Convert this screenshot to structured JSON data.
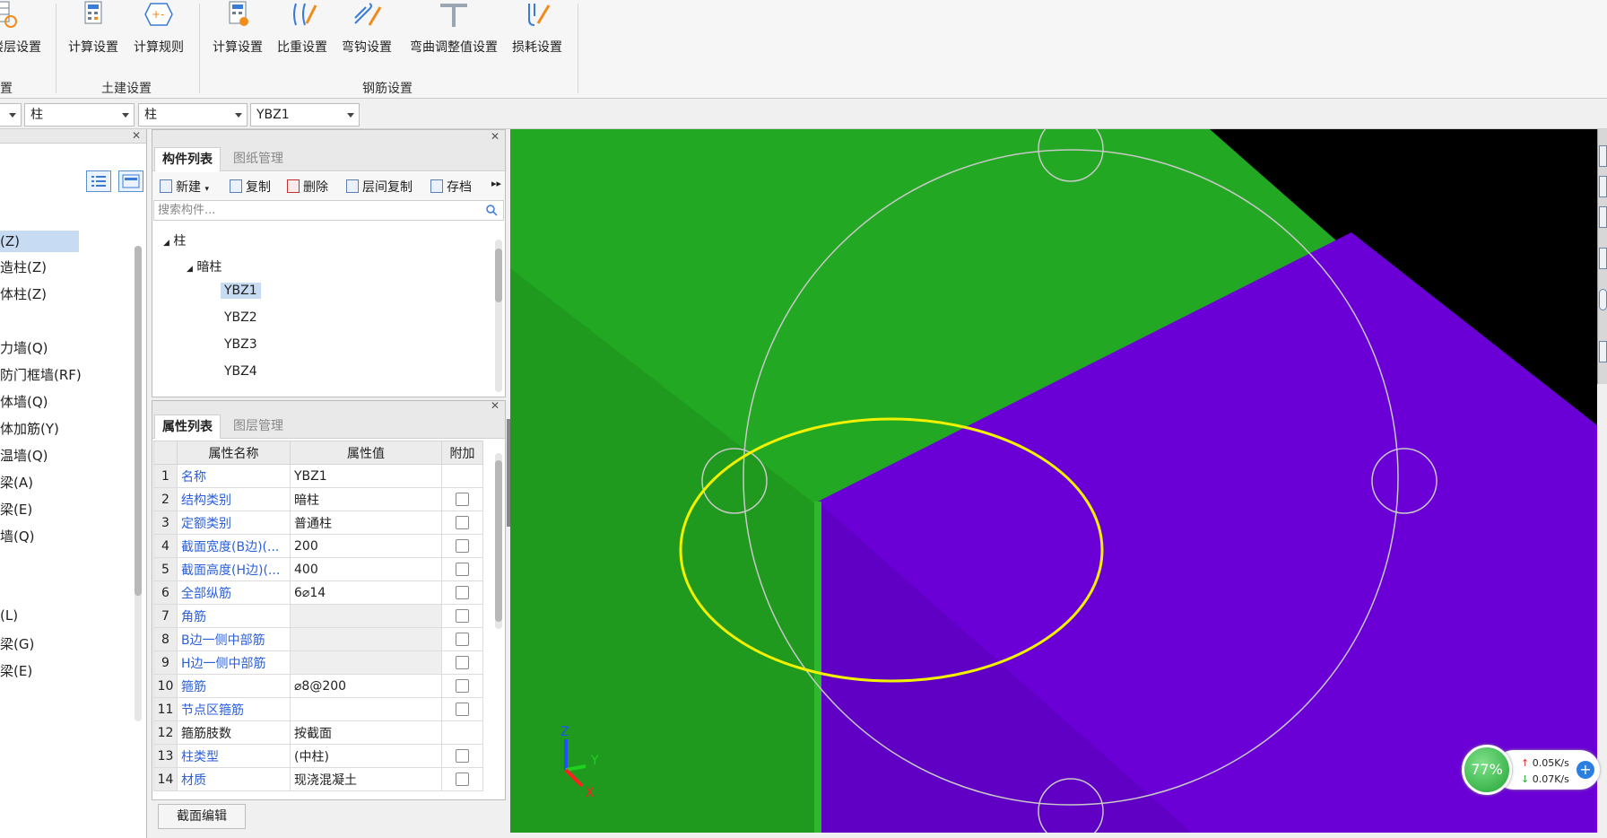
{
  "ribbon": {
    "buttons": [
      {
        "label": "楼层设置",
        "icon": "floor-settings-icon"
      },
      {
        "label": "计算设置",
        "icon": "calc-settings-icon"
      },
      {
        "label": "计算规则",
        "icon": "calc-rules-icon"
      },
      {
        "label": "计算设置",
        "icon": "rebar-calc-settings-icon"
      },
      {
        "label": "比重设置",
        "icon": "specific-gravity-icon"
      },
      {
        "label": "弯钩设置",
        "icon": "hook-settings-icon"
      },
      {
        "label": "弯曲调整值设置",
        "icon": "bend-adjust-icon"
      },
      {
        "label": "损耗设置",
        "icon": "loss-settings-icon"
      }
    ],
    "groups": {
      "left_partial": "置",
      "civil": "土建设置",
      "rebar": "钢筋设置"
    }
  },
  "selectors": {
    "combo1": "柱",
    "combo2": "柱",
    "combo3": "YBZ1"
  },
  "left_nav": {
    "items": [
      "(Z)",
      "造柱(Z)",
      "体柱(Z)",
      "力墙(Q)",
      "防门框墙(RF)",
      "体墙(Q)",
      "体加筋(Y)",
      "温墙(Q)",
      "梁(A)",
      "梁(E)",
      "墙(Q)",
      "(L)",
      "梁(G)",
      "梁(E)"
    ]
  },
  "component_list": {
    "tabs": [
      "构件列表",
      "图纸管理"
    ],
    "toolbar": {
      "new": "新建",
      "copy": "复制",
      "delete": "删除",
      "floor_copy": "层间复制",
      "archive": "存档"
    },
    "search_placeholder": "搜索构件...",
    "tree": {
      "root": "柱",
      "child": "暗柱",
      "items": [
        "YBZ1",
        "YBZ2",
        "YBZ3",
        "YBZ4"
      ],
      "selected": "YBZ1"
    }
  },
  "property_list": {
    "tabs": [
      "属性列表",
      "图层管理"
    ],
    "headers": [
      "属性名称",
      "属性值",
      "附加"
    ],
    "rows": [
      {
        "n": "1",
        "name": "名称",
        "value": "YBZ1",
        "cb": false
      },
      {
        "n": "2",
        "name": "结构类别",
        "value": "暗柱",
        "cb": true
      },
      {
        "n": "3",
        "name": "定额类别",
        "value": "普通柱",
        "cb": true
      },
      {
        "n": "4",
        "name": "截面宽度(B边)(...",
        "value": "200",
        "cb": true
      },
      {
        "n": "5",
        "name": "截面高度(H边)(...",
        "value": "400",
        "cb": true
      },
      {
        "n": "6",
        "name": "全部纵筋",
        "value": "6⌀14",
        "cb": true
      },
      {
        "n": "7",
        "name": "角筋",
        "value": "",
        "cb": true
      },
      {
        "n": "8",
        "name": "B边一侧中部筋",
        "value": "",
        "cb": true
      },
      {
        "n": "9",
        "name": "H边一侧中部筋",
        "value": "",
        "cb": true
      },
      {
        "n": "10",
        "name": "箍筋",
        "value": "⌀8@200",
        "cb": true
      },
      {
        "n": "11",
        "name": "节点区箍筋",
        "value": "",
        "cb": true
      },
      {
        "n": "12",
        "name": "箍筋肢数",
        "value": "按截面",
        "cb": false
      },
      {
        "n": "13",
        "name": "柱类型",
        "value": "(中柱)",
        "cb": true
      },
      {
        "n": "14",
        "name": "材质",
        "value": "现浇混凝土",
        "cb": true
      }
    ],
    "section_edit": "截面编辑"
  },
  "viewport": {
    "colors": {
      "green": "#22a822",
      "green_dark": "#1f9a1f",
      "purple": "#6a00d6",
      "purple_dark": "#5f00c4",
      "black": "#000000",
      "ellipse": "#f2f200"
    },
    "axes": {
      "x": "X",
      "y": "Y",
      "z": "Z"
    }
  },
  "net_widget": {
    "percent": "77%",
    "up": "0.05K/s",
    "down": "0.07K/s"
  }
}
